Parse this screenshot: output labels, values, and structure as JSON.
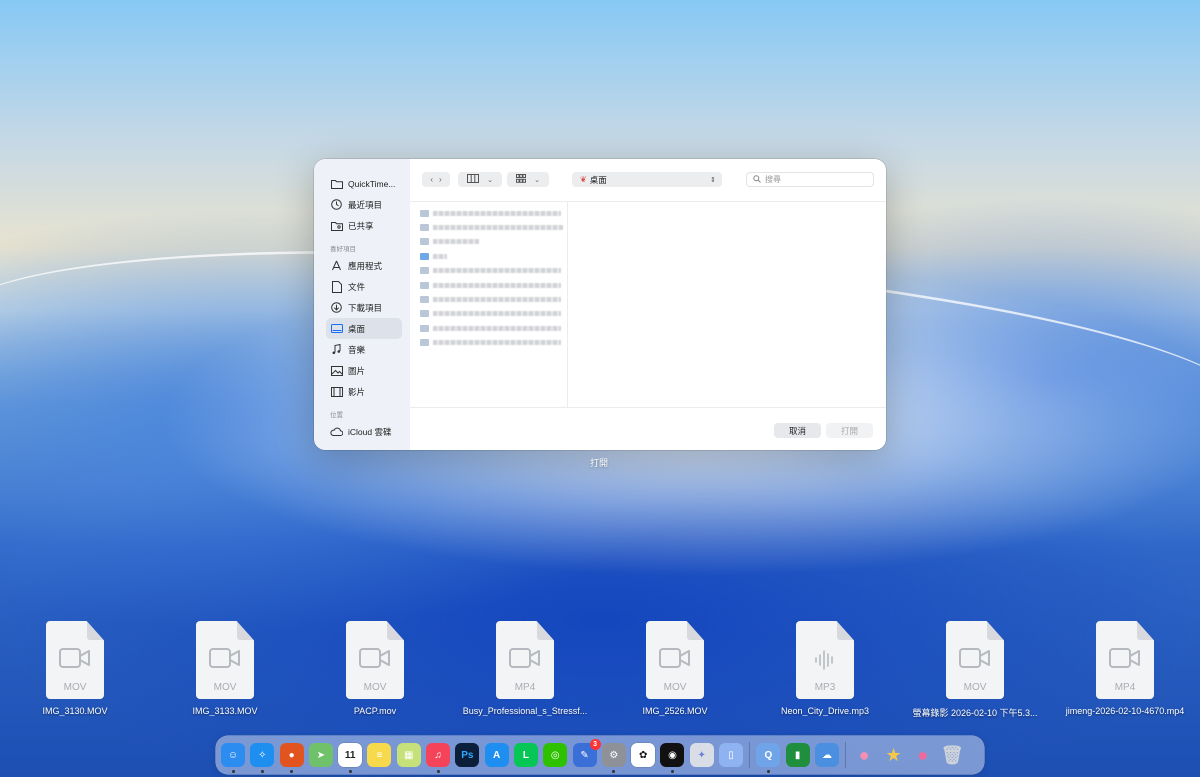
{
  "dialog": {
    "sidebar": {
      "top_items": [
        {
          "label": "QuickTime...",
          "icon": "folder-icon"
        },
        {
          "label": "最近項目",
          "icon": "clock-icon"
        },
        {
          "label": "已共享",
          "icon": "shared-folder-icon"
        }
      ],
      "favorites_header": "喜好項目",
      "favorites": [
        {
          "label": "應用程式",
          "icon": "applications-icon"
        },
        {
          "label": "文件",
          "icon": "document-icon"
        },
        {
          "label": "下載項目",
          "icon": "download-icon"
        },
        {
          "label": "桌面",
          "icon": "desktop-icon",
          "active": true
        },
        {
          "label": "音樂",
          "icon": "music-icon"
        },
        {
          "label": "圖片",
          "icon": "photo-icon"
        },
        {
          "label": "影片",
          "icon": "film-icon"
        }
      ],
      "locations_header": "位置",
      "locations": [
        {
          "label": "iCloud 雲碟",
          "icon": "cloud-icon"
        }
      ]
    },
    "toolbar": {
      "back_icon": "chevron-left-icon",
      "forward_icon": "chevron-right-icon",
      "view_icon": "column-view-icon",
      "group_icon": "grid-icon",
      "location": "桌面",
      "search_placeholder": "搜尋"
    },
    "file_count": 10,
    "buttons": {
      "cancel": "取消",
      "open": "打開"
    },
    "caption": "打開"
  },
  "desktop_files": [
    {
      "name": "IMG_3130.MOV",
      "ext": "MOV",
      "kind": "video"
    },
    {
      "name": "IMG_3133.MOV",
      "ext": "MOV",
      "kind": "video"
    },
    {
      "name": "PACP.mov",
      "ext": "MOV",
      "kind": "video"
    },
    {
      "name": "Busy_Professional_s_Stressf...",
      "ext": "MP4",
      "kind": "video"
    },
    {
      "name": "IMG_2526.MOV",
      "ext": "MOV",
      "kind": "video"
    },
    {
      "name": "Neon_City_Drive.mp3",
      "ext": "MP3",
      "kind": "audio"
    },
    {
      "name": "螢幕錄影 2026-02-10 下午5.3...",
      "ext": "MOV",
      "kind": "video"
    },
    {
      "name": "jimeng-2026-02-10-4670.mp4",
      "ext": "MP4",
      "kind": "video"
    }
  ],
  "dock": {
    "apps": [
      {
        "name": "finder-icon",
        "glyph": "☺",
        "bg": "#2d8cf0",
        "running": true
      },
      {
        "name": "safari-icon",
        "glyph": "✧",
        "bg": "#1f8ef1",
        "running": true
      },
      {
        "name": "firefox-icon",
        "glyph": "●",
        "bg": "#e2541f",
        "running": true
      },
      {
        "name": "maps-icon",
        "glyph": "➤",
        "bg": "#6fc16a",
        "running": false
      },
      {
        "name": "calendar-icon",
        "glyph": "11",
        "bg": "#ffffff",
        "fg": "#222",
        "running": true
      },
      {
        "name": "notes-icon",
        "glyph": "≡",
        "bg": "#f7d94c",
        "running": false
      },
      {
        "name": "stickies-icon",
        "glyph": "▦",
        "bg": "#c6e07a",
        "running": false
      },
      {
        "name": "music-icon",
        "glyph": "♫",
        "bg": "#f5435a",
        "running": true
      },
      {
        "name": "photoshop-icon",
        "glyph": "Ps",
        "bg": "#0b1f3a",
        "fg": "#31a8ff",
        "running": false
      },
      {
        "name": "app-store-icon",
        "glyph": "A",
        "bg": "#1f8ef1",
        "running": false
      },
      {
        "name": "line-icon",
        "glyph": "L",
        "bg": "#06c755",
        "running": false
      },
      {
        "name": "wechat-icon",
        "glyph": "◎",
        "bg": "#2dc100",
        "running": false
      },
      {
        "name": "notion-calendar-icon",
        "glyph": "✎",
        "bg": "#3a6fd8",
        "running": false,
        "badge": "3"
      },
      {
        "name": "system-settings-icon",
        "glyph": "⚙",
        "bg": "#8e9298",
        "running": true
      },
      {
        "name": "chatgpt-icon",
        "glyph": "✿",
        "bg": "#ffffff",
        "fg": "#111",
        "running": false
      },
      {
        "name": "perplexity-icon",
        "glyph": "◉",
        "bg": "#111111",
        "running": true
      },
      {
        "name": "spark-icon",
        "glyph": "✦",
        "bg": "#d9dde6",
        "fg": "#6a7fd8",
        "running": false
      },
      {
        "name": "simulator-icon",
        "glyph": "▯",
        "bg": "#8fb2f0",
        "running": false
      }
    ],
    "apps2": [
      {
        "name": "quicktime-icon",
        "glyph": "Q",
        "bg": "#6fa5e8",
        "running": true
      },
      {
        "name": "numbers-icon",
        "glyph": "▮",
        "bg": "#1f8f3e",
        "running": false
      },
      {
        "name": "weather-icon",
        "glyph": "☁",
        "bg": "#4a8fe0",
        "running": false
      }
    ],
    "stickers": [
      {
        "name": "kirby-sticker-icon",
        "glyph": "●",
        "bg": "transparent",
        "fg": "#f48fb1"
      },
      {
        "name": "kirby-star-sticker-icon",
        "glyph": "★",
        "bg": "transparent",
        "fg": "#f7c948"
      },
      {
        "name": "kirby-shout-sticker-icon",
        "glyph": "●",
        "bg": "transparent",
        "fg": "#ef6a9a"
      },
      {
        "name": "trash-icon",
        "glyph": "🗑",
        "bg": "transparent",
        "fg": "#cfd3da"
      }
    ]
  }
}
